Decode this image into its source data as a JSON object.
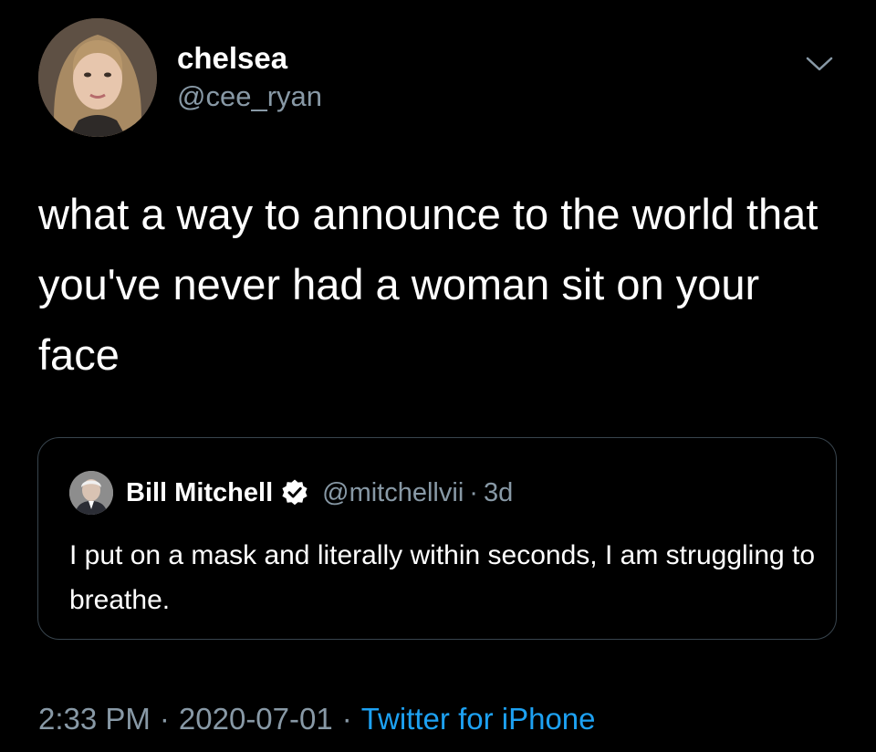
{
  "tweet": {
    "author": {
      "display_name": "chelsea",
      "handle": "@cee_ryan"
    },
    "text": "what a way to announce to the world that you've never had a woman sit on your face",
    "quoted_tweet": {
      "display_name": "Bill Mitchell",
      "verified": true,
      "handle": "@mitchellvii",
      "separator": "·",
      "time": "3d",
      "text": "I put on a mask and literally within seconds, I am struggling to breathe."
    },
    "time": "2:33 PM",
    "separator": "·",
    "date": "2020-07-01",
    "source": "Twitter for iPhone"
  },
  "colors": {
    "background": "#000000",
    "text_primary": "#ffffff",
    "text_secondary": "#8899a6",
    "link": "#1da1f2",
    "border": "#38444d"
  },
  "icons": {
    "more": "chevron-down-icon",
    "verified": "verified-badge-icon"
  }
}
